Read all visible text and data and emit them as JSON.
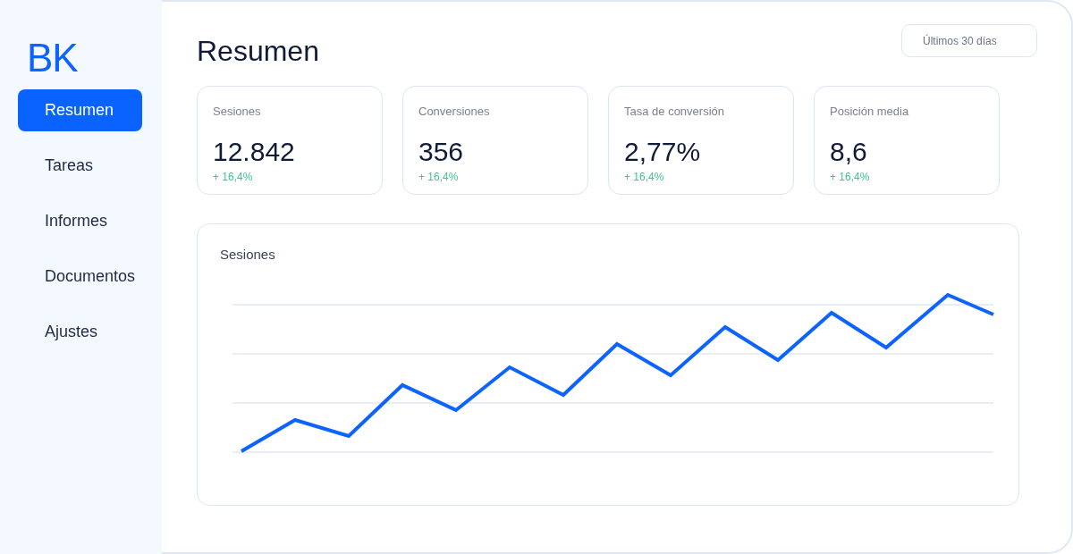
{
  "logo": "BK",
  "nav": [
    {
      "label": "Resumen",
      "selected": true
    },
    {
      "label": "Tareas",
      "selected": false
    },
    {
      "label": "Informes",
      "selected": false
    },
    {
      "label": "Documentos",
      "selected": false
    },
    {
      "label": "Ajustes",
      "selected": false
    }
  ],
  "header": {
    "title": "Resumen",
    "date_range": "Últimos 30 días"
  },
  "metrics": [
    {
      "label": "Sesiones",
      "value": "12.842",
      "change": "+ 16,4%"
    },
    {
      "label": "Conversiones",
      "value": "356",
      "change": "+ 16,4%"
    },
    {
      "label": "Tasa de conversión",
      "value": "2,77%",
      "change": "+ 16,4%"
    },
    {
      "label": "Posición media",
      "value": "8,6",
      "change": "+ 16,4%"
    }
  ],
  "chart": {
    "title": "Sesiones"
  }
}
